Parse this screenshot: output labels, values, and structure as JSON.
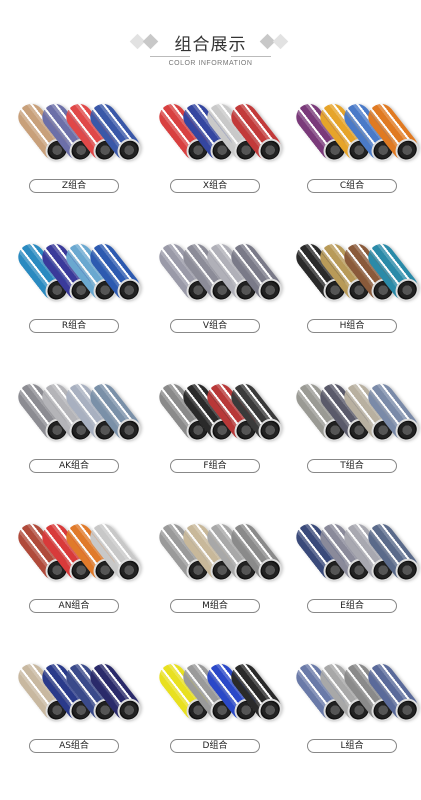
{
  "header": {
    "title": "组合展示",
    "subtitle": "COLOR INFORMATION"
  },
  "combos": [
    {
      "label": "Z组合",
      "colors": [
        "#c8a07a",
        "#6c6fa8",
        "#e04848",
        "#3a58a8"
      ]
    },
    {
      "label": "X组合",
      "colors": [
        "#d84040",
        "#3446a0",
        "#c9c9c9",
        "#c23a3a"
      ]
    },
    {
      "label": "C组合",
      "colors": [
        "#7a3a7a",
        "#e6a42a",
        "#4a7ac8",
        "#e07a22"
      ]
    },
    {
      "label": "R组合",
      "colors": [
        "#2a8ac0",
        "#3a3a9a",
        "#6aa8d0",
        "#2d5ab0"
      ]
    },
    {
      "label": "V组合",
      "colors": [
        "#9a9aa8",
        "#8c8c98",
        "#b0b0b8",
        "#7a7a88"
      ]
    },
    {
      "label": "H组合",
      "colors": [
        "#2a2a2a",
        "#b89a58",
        "#8a5a3a",
        "#2a8aa8"
      ]
    },
    {
      "label": "AK组合",
      "colors": [
        "#8c8c92",
        "#b4b4b8",
        "#a8b0c0",
        "#7a90a8"
      ]
    },
    {
      "label": "F组合",
      "colors": [
        "#8a8a8a",
        "#2a2a2a",
        "#b83838",
        "#3a3a3a"
      ]
    },
    {
      "label": "T组合",
      "colors": [
        "#9a9a94",
        "#5a5a6a",
        "#b8b0a0",
        "#7a8aa8"
      ]
    },
    {
      "label": "AN组合",
      "colors": [
        "#b04a3a",
        "#d83a3a",
        "#e07a2a",
        "#c8c8c8"
      ]
    },
    {
      "label": "M组合",
      "colors": [
        "#9a9a9a",
        "#c8b89a",
        "#a8a8a8",
        "#8a8a8a"
      ]
    },
    {
      "label": "E组合",
      "colors": [
        "#3a4a7a",
        "#8a8a9a",
        "#a8a8b0",
        "#5a6a8a"
      ]
    },
    {
      "label": "AS组合",
      "colors": [
        "#c8b8a0",
        "#2a3a8a",
        "#3a4a8a",
        "#2a2a6a"
      ]
    },
    {
      "label": "D组合",
      "colors": [
        "#e8e020",
        "#9a9a9a",
        "#2a48c8",
        "#2a2a2a"
      ]
    },
    {
      "label": "L组合",
      "colors": [
        "#6a7aa8",
        "#a8a8a8",
        "#8a8a8a",
        "#5a6a9a"
      ]
    }
  ]
}
